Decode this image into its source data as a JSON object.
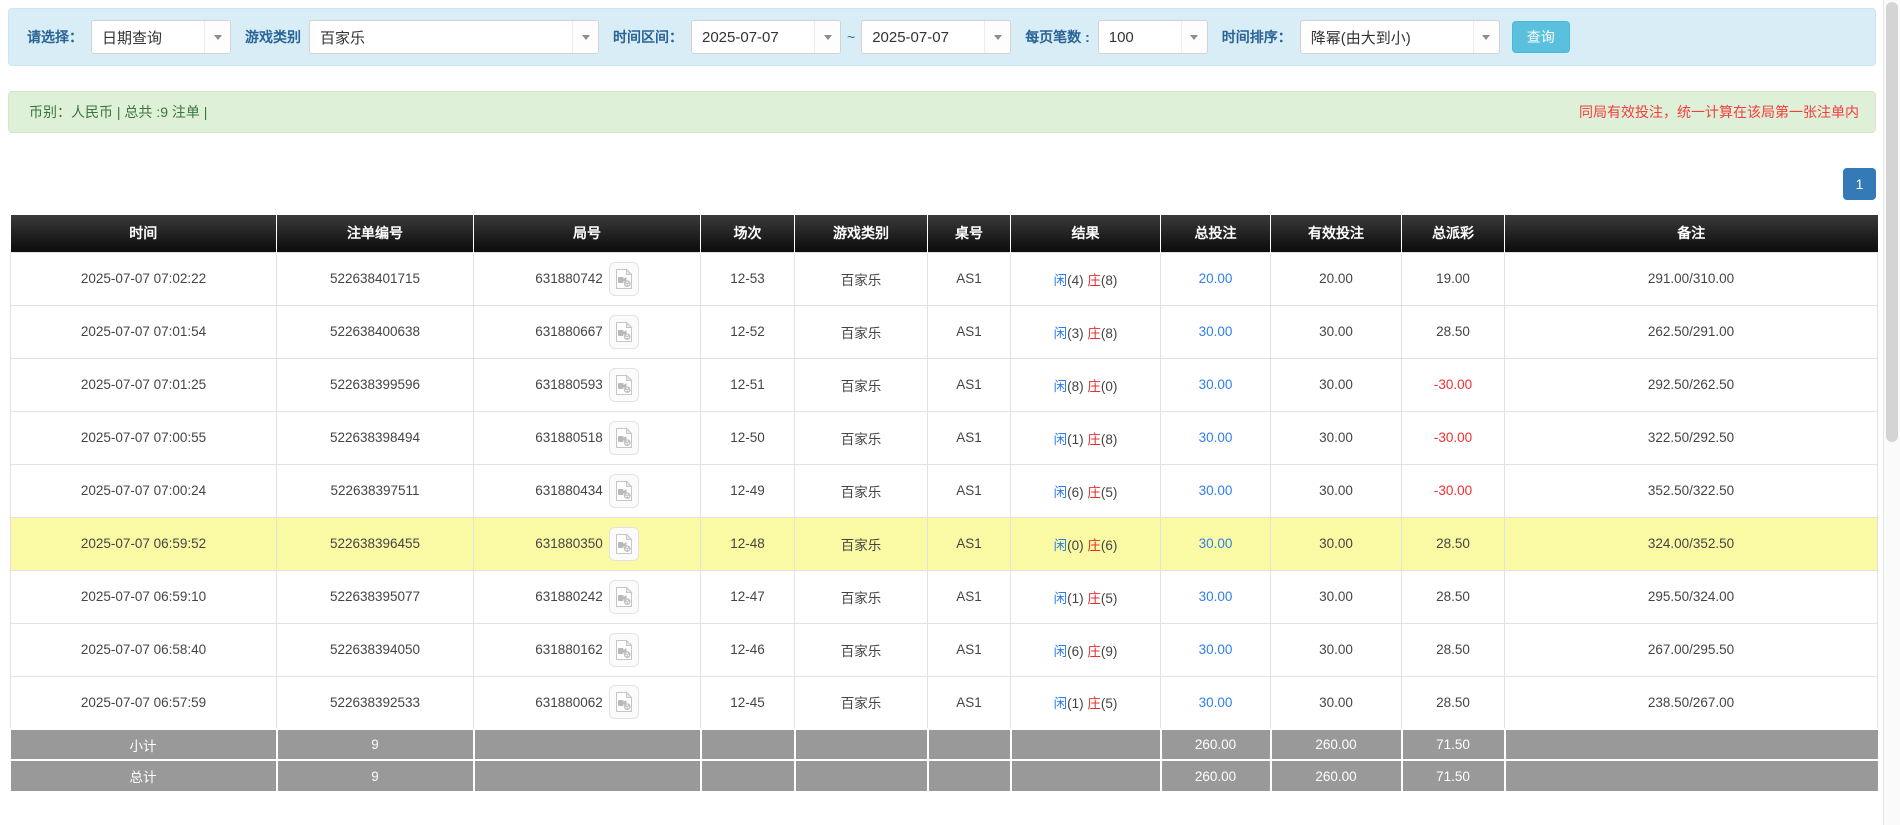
{
  "filter_bar": {
    "select_label": "请选择：",
    "select_value": "日期查询",
    "game_label": "游戏类别",
    "game_value": "百家乐",
    "time_range_label": "时间区间：",
    "date_from": "2025-07-07",
    "tilde": "~",
    "date_to": "2025-07-07",
    "page_size_label": "每页笔数 :",
    "page_size_value": "100",
    "sort_label": "时间排序：",
    "sort_value": "降幂(由大到小)",
    "query_button": "查询"
  },
  "summary_bar": {
    "left_text": "币别：人民币 | 总共 :9 注单 |",
    "right_notice": "同局有效投注，统一计算在该局第一张注单内"
  },
  "pagination": {
    "current_page": "1"
  },
  "table": {
    "headers": [
      "时间",
      "注单编号",
      "局号",
      "场次",
      "游戏类别",
      "桌号",
      "结果",
      "总投注",
      "有效投注",
      "总派彩",
      "备注"
    ],
    "rows": [
      {
        "time": "2025-07-07 07:02:22",
        "bet_id": "522638401715",
        "round_id": "631880742",
        "session": "12-53",
        "game": "百家乐",
        "table_no": "AS1",
        "result_player_label": "闲",
        "result_player": "(4)",
        "result_banker_label": "庄",
        "result_banker": "(8)",
        "total_bet": "20.00",
        "valid_bet": "20.00",
        "payout": "19.00",
        "remark": "291.00/310.00",
        "highlighted": false
      },
      {
        "time": "2025-07-07 07:01:54",
        "bet_id": "522638400638",
        "round_id": "631880667",
        "session": "12-52",
        "game": "百家乐",
        "table_no": "AS1",
        "result_player_label": "闲",
        "result_player": "(3)",
        "result_banker_label": "庄",
        "result_banker": "(8)",
        "total_bet": "30.00",
        "valid_bet": "30.00",
        "payout": "28.50",
        "remark": "262.50/291.00",
        "highlighted": false
      },
      {
        "time": "2025-07-07 07:01:25",
        "bet_id": "522638399596",
        "round_id": "631880593",
        "session": "12-51",
        "game": "百家乐",
        "table_no": "AS1",
        "result_player_label": "闲",
        "result_player": "(8)",
        "result_banker_label": "庄",
        "result_banker": "(0)",
        "total_bet": "30.00",
        "valid_bet": "30.00",
        "payout": "-30.00",
        "remark": "292.50/262.50",
        "highlighted": false
      },
      {
        "time": "2025-07-07 07:00:55",
        "bet_id": "522638398494",
        "round_id": "631880518",
        "session": "12-50",
        "game": "百家乐",
        "table_no": "AS1",
        "result_player_label": "闲",
        "result_player": "(1)",
        "result_banker_label": "庄",
        "result_banker": "(8)",
        "total_bet": "30.00",
        "valid_bet": "30.00",
        "payout": "-30.00",
        "remark": "322.50/292.50",
        "highlighted": false
      },
      {
        "time": "2025-07-07 07:00:24",
        "bet_id": "522638397511",
        "round_id": "631880434",
        "session": "12-49",
        "game": "百家乐",
        "table_no": "AS1",
        "result_player_label": "闲",
        "result_player": "(6)",
        "result_banker_label": "庄",
        "result_banker": "(5)",
        "total_bet": "30.00",
        "valid_bet": "30.00",
        "payout": "-30.00",
        "remark": "352.50/322.50",
        "highlighted": false
      },
      {
        "time": "2025-07-07 06:59:52",
        "bet_id": "522638396455",
        "round_id": "631880350",
        "session": "12-48",
        "game": "百家乐",
        "table_no": "AS1",
        "result_player_label": "闲",
        "result_player": "(0)",
        "result_banker_label": "庄",
        "result_banker": "(6)",
        "total_bet": "30.00",
        "valid_bet": "30.00",
        "payout": "28.50",
        "remark": "324.00/352.50",
        "highlighted": true
      },
      {
        "time": "2025-07-07 06:59:10",
        "bet_id": "522638395077",
        "round_id": "631880242",
        "session": "12-47",
        "game": "百家乐",
        "table_no": "AS1",
        "result_player_label": "闲",
        "result_player": "(1)",
        "result_banker_label": "庄",
        "result_banker": "(5)",
        "total_bet": "30.00",
        "valid_bet": "30.00",
        "payout": "28.50",
        "remark": "295.50/324.00",
        "highlighted": false
      },
      {
        "time": "2025-07-07 06:58:40",
        "bet_id": "522638394050",
        "round_id": "631880162",
        "session": "12-46",
        "game": "百家乐",
        "table_no": "AS1",
        "result_player_label": "闲",
        "result_player": "(6)",
        "result_banker_label": "庄",
        "result_banker": "(9)",
        "total_bet": "30.00",
        "valid_bet": "30.00",
        "payout": "28.50",
        "remark": "267.00/295.50",
        "highlighted": false
      },
      {
        "time": "2025-07-07 06:57:59",
        "bet_id": "522638392533",
        "round_id": "631880062",
        "session": "12-45",
        "game": "百家乐",
        "table_no": "AS1",
        "result_player_label": "闲",
        "result_player": "(1)",
        "result_banker_label": "庄",
        "result_banker": "(5)",
        "total_bet": "30.00",
        "valid_bet": "30.00",
        "payout": "28.50",
        "remark": "238.50/267.00",
        "highlighted": false
      }
    ],
    "subtotal": {
      "label": "小计",
      "count": "9",
      "total_bet": "260.00",
      "valid_bet": "260.00",
      "payout": "71.50"
    },
    "total": {
      "label": "总计",
      "count": "9",
      "total_bet": "260.00",
      "valid_bet": "260.00",
      "payout": "71.50"
    }
  },
  "colors": {
    "panel_blue_bg": "#d9edf7",
    "label_blue": "#2a6496",
    "query_button_bg": "#5bc0de",
    "summary_green_bg": "#dff0d8",
    "summary_green_text": "#3c763d",
    "notice_red": "#f23d3d",
    "pagination_blue": "#337ab7",
    "header_black": "#151515",
    "highlight_yellow": "#fafaa5",
    "footer_gray": "#999999",
    "link_blue": "#2f80ed",
    "player_blue": "#2b7de9",
    "banker_red": "#e03131",
    "negative_red": "#f03030"
  }
}
